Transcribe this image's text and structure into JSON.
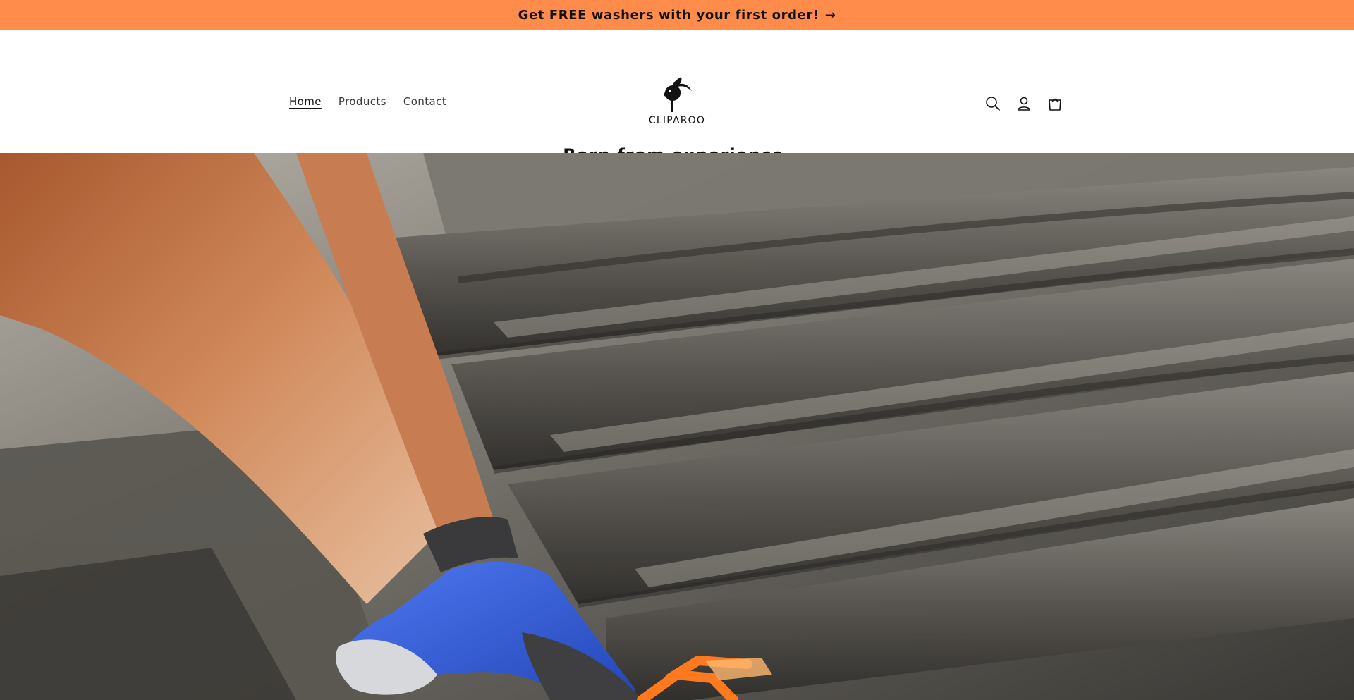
{
  "announcement": {
    "text": "Get FREE washers with your first order!",
    "arrow_icon": "arrow-right-icon"
  },
  "header": {
    "nav": [
      {
        "label": "Home",
        "active": true
      },
      {
        "label": "Products",
        "active": false
      },
      {
        "label": "Contact",
        "active": false
      }
    ],
    "logo": {
      "text": "CLIPAROO",
      "icon": "cockatoo-logo-icon"
    },
    "icons": [
      "search-icon",
      "account-icon",
      "cart-icon"
    ]
  },
  "tagline": "Born from experience.",
  "hero": {
    "image": "photo-gloved-hand-attaching-orange-clip-to-roof-tiles",
    "colors": {
      "roof": "#4a4844",
      "glove": "#3a5fd8",
      "clip": "#ff7a1e",
      "arm": "#c9774c"
    }
  },
  "colors": {
    "announcement_bg": "#ff8c4a",
    "text": "#121212",
    "background": "#ffffff"
  }
}
